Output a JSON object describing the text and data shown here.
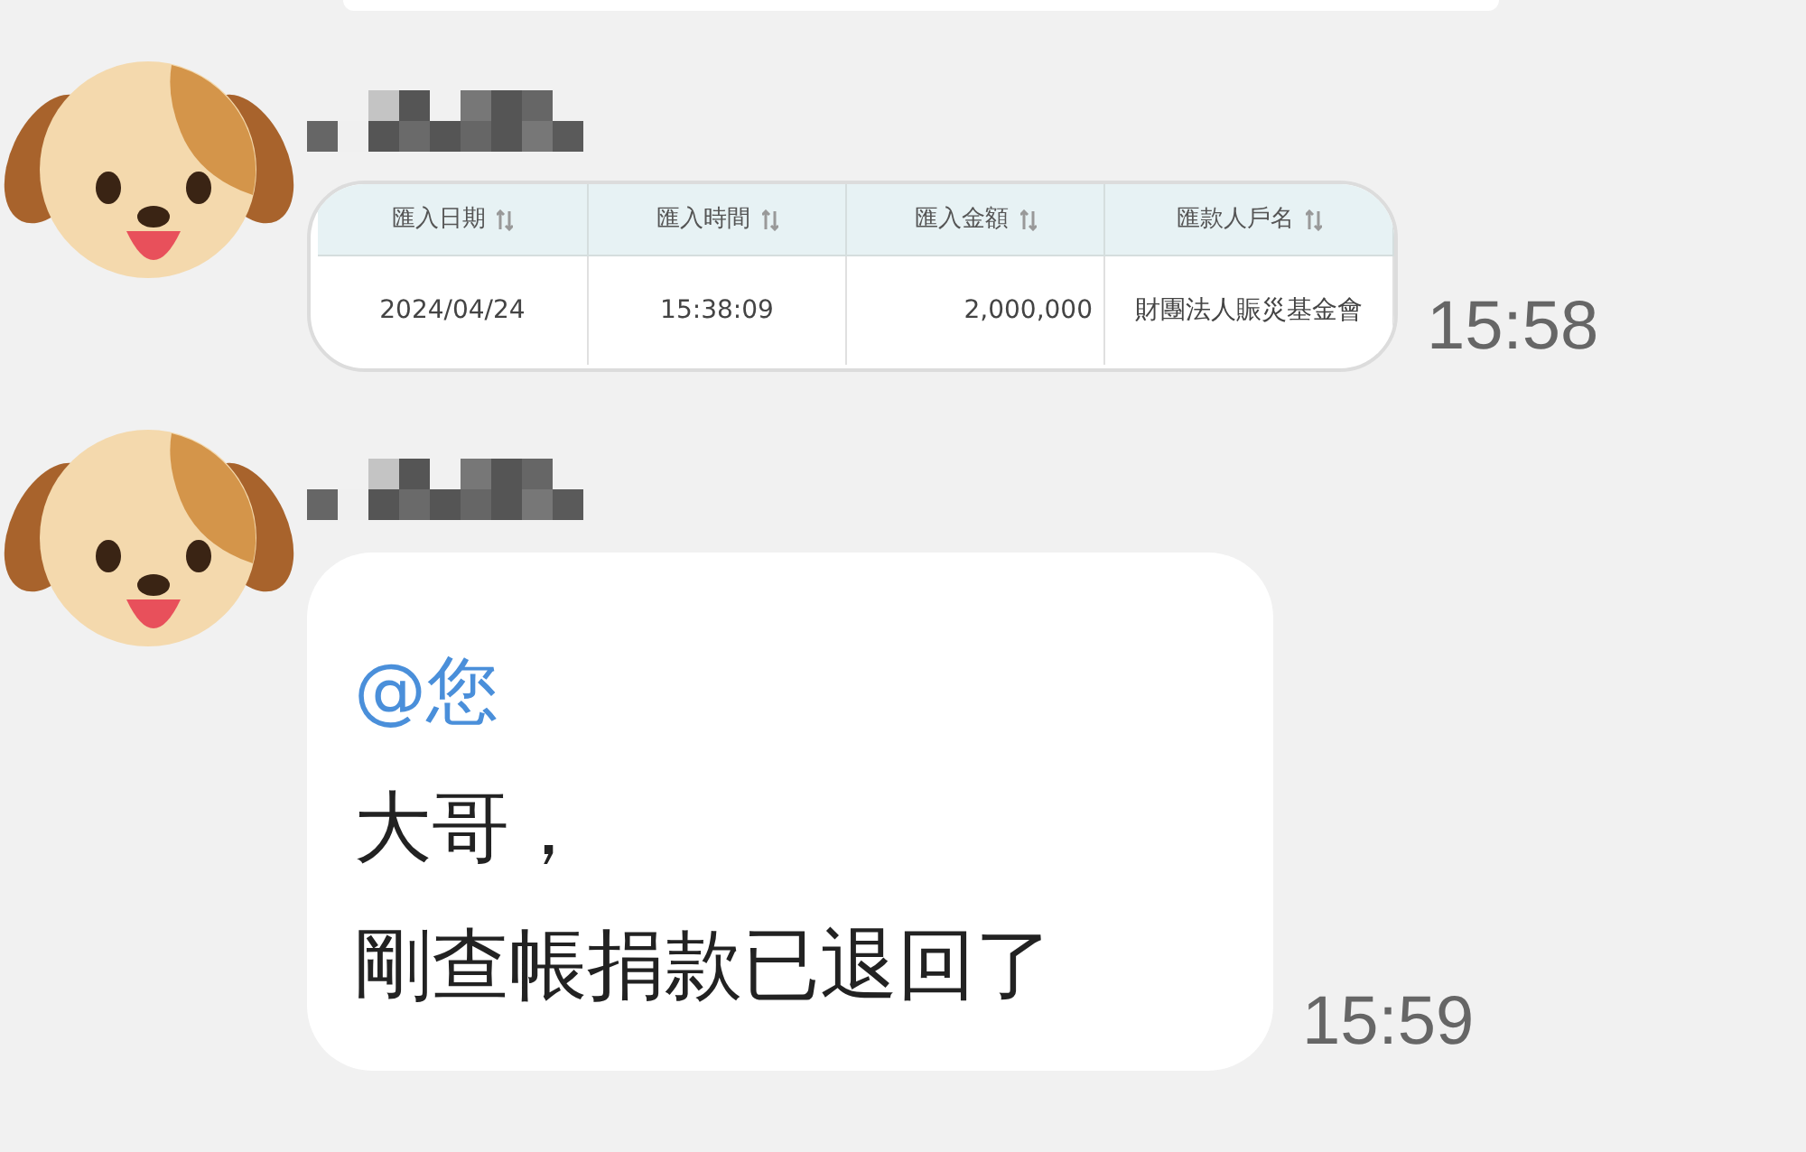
{
  "messages": [
    {
      "kind": "cutoff"
    },
    {
      "kind": "image_table",
      "time": "15:58",
      "table": {
        "columns": [
          {
            "label": "匯入日期",
            "kind": "text"
          },
          {
            "label": "匯入時間",
            "kind": "text"
          },
          {
            "label": "匯入金額",
            "kind": "number"
          },
          {
            "label": "匯款人戶名",
            "kind": "text"
          }
        ],
        "rows": [
          [
            "2024/04/24",
            "15:38:09",
            "2,000,000",
            "財團法人賑災基金會"
          ]
        ]
      }
    },
    {
      "kind": "text",
      "time": "15:59",
      "lines": [
        {
          "kind": "mention",
          "text": "@您"
        },
        {
          "kind": "plain",
          "text": "大哥，"
        },
        {
          "kind": "plain",
          "text": "剛查帳捐款已退回了"
        }
      ]
    }
  ]
}
